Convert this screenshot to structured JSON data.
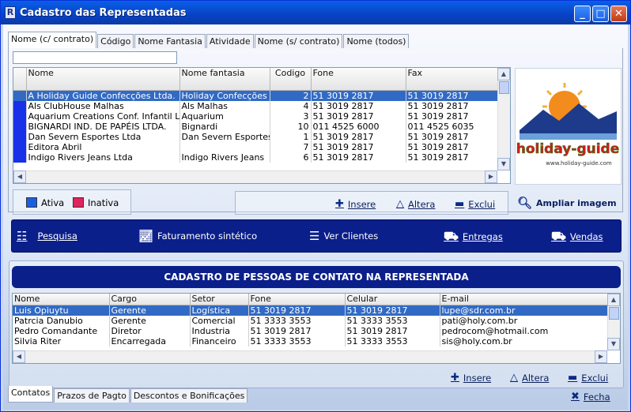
{
  "window": {
    "title": "Cadastro das Representadas",
    "app_icon_glyph": "R"
  },
  "top_tabs": [
    "Nome (c/ contrato)",
    "Código",
    "Nome Fantasia",
    "Atividade",
    "Nome (s/ contrato)",
    "Nome (todos)"
  ],
  "search": {
    "value": ""
  },
  "main_grid": {
    "columns": [
      "Nome",
      "Nome fantasia",
      "Codigo",
      "Fone",
      "Fax"
    ],
    "rows": [
      [
        "A Holiday Guide Confecções Ltda.",
        "Holiday Confecções",
        "2",
        "51 3019 2817",
        "51 3019 2817"
      ],
      [
        "Als ClubHouse Malhas",
        "Als Malhas",
        "4",
        "51 3019 2817",
        "51 3019 2817"
      ],
      [
        "Aquarium Creations Conf. Infantil Ltda",
        "Aquarium",
        "3",
        "51 3019 2817",
        "51 3019 2817"
      ],
      [
        "BIGNARDI IND. DE PAPÉIS LTDA.",
        "Bignardi",
        "10",
        "011 4525 6000",
        "011 4525 6035"
      ],
      [
        "Dan Severn Esportes Ltda",
        "Dan Severn Esportes",
        "1",
        "51 3019 2817",
        "51 3019 2817"
      ],
      [
        "Editora Abril",
        "",
        "7",
        "51 3019 2817",
        "51 3019 2817"
      ],
      [
        "Indigo Rivers Jeans Ltda",
        "Indigo Rivers Jeans",
        "6",
        "51 3019 2817",
        "51 3019 2817"
      ]
    ],
    "selected_row": 0
  },
  "logo": {
    "text": "holiday-guide",
    "url_text": "www.holiday-guide.com"
  },
  "legend": {
    "ativa": "Ativa",
    "inativa": "Inativa",
    "ativa_color": "#1a5fe0",
    "inativa_color": "#e0245e"
  },
  "record_actions": {
    "insere": "Insere",
    "altera": "Altera",
    "exclui": "Exclui"
  },
  "ampliar": "Ampliar imagem",
  "toolbar": {
    "pesquisa": "Pesquisa",
    "faturamento": "Faturamento sintético",
    "ver_clientes": "Ver Clientes",
    "entregas": "Entregas",
    "vendas": "Vendas"
  },
  "contacts": {
    "title": "CADASTRO DE PESSOAS DE CONTATO NA REPRESENTADA",
    "columns": [
      "Nome",
      "Cargo",
      "Setor",
      "Fone",
      "Celular",
      "E-mail"
    ],
    "rows": [
      [
        "Luis Opiuytu",
        "Gerente",
        "Logística",
        "51 3019 2817",
        "51 3019 2817",
        "lupe@sdr.com.br"
      ],
      [
        "Patrcia Danubio",
        "Gerente",
        "Comercial",
        "51 3333 3553",
        "51 3333 3553",
        "pati@holy.com.br"
      ],
      [
        "Pedro Comandante",
        "Diretor",
        "Industria",
        "51 3019 2817",
        "51 3019 2817",
        "pedrocom@hotmail.com"
      ],
      [
        "Silvia Riter",
        "Encarregada",
        "Financeiro",
        "51 3333 3553",
        "51 3333 3553",
        "sis@holy.com.br"
      ]
    ],
    "selected_row": 0
  },
  "contact_actions": {
    "insere": "Insere",
    "altera": "Altera",
    "exclui": "Exclui"
  },
  "bottom_tabs": [
    "Contatos",
    "Prazos de Pagto",
    "Descontos e Bonificações"
  ],
  "fecha": "Fecha"
}
